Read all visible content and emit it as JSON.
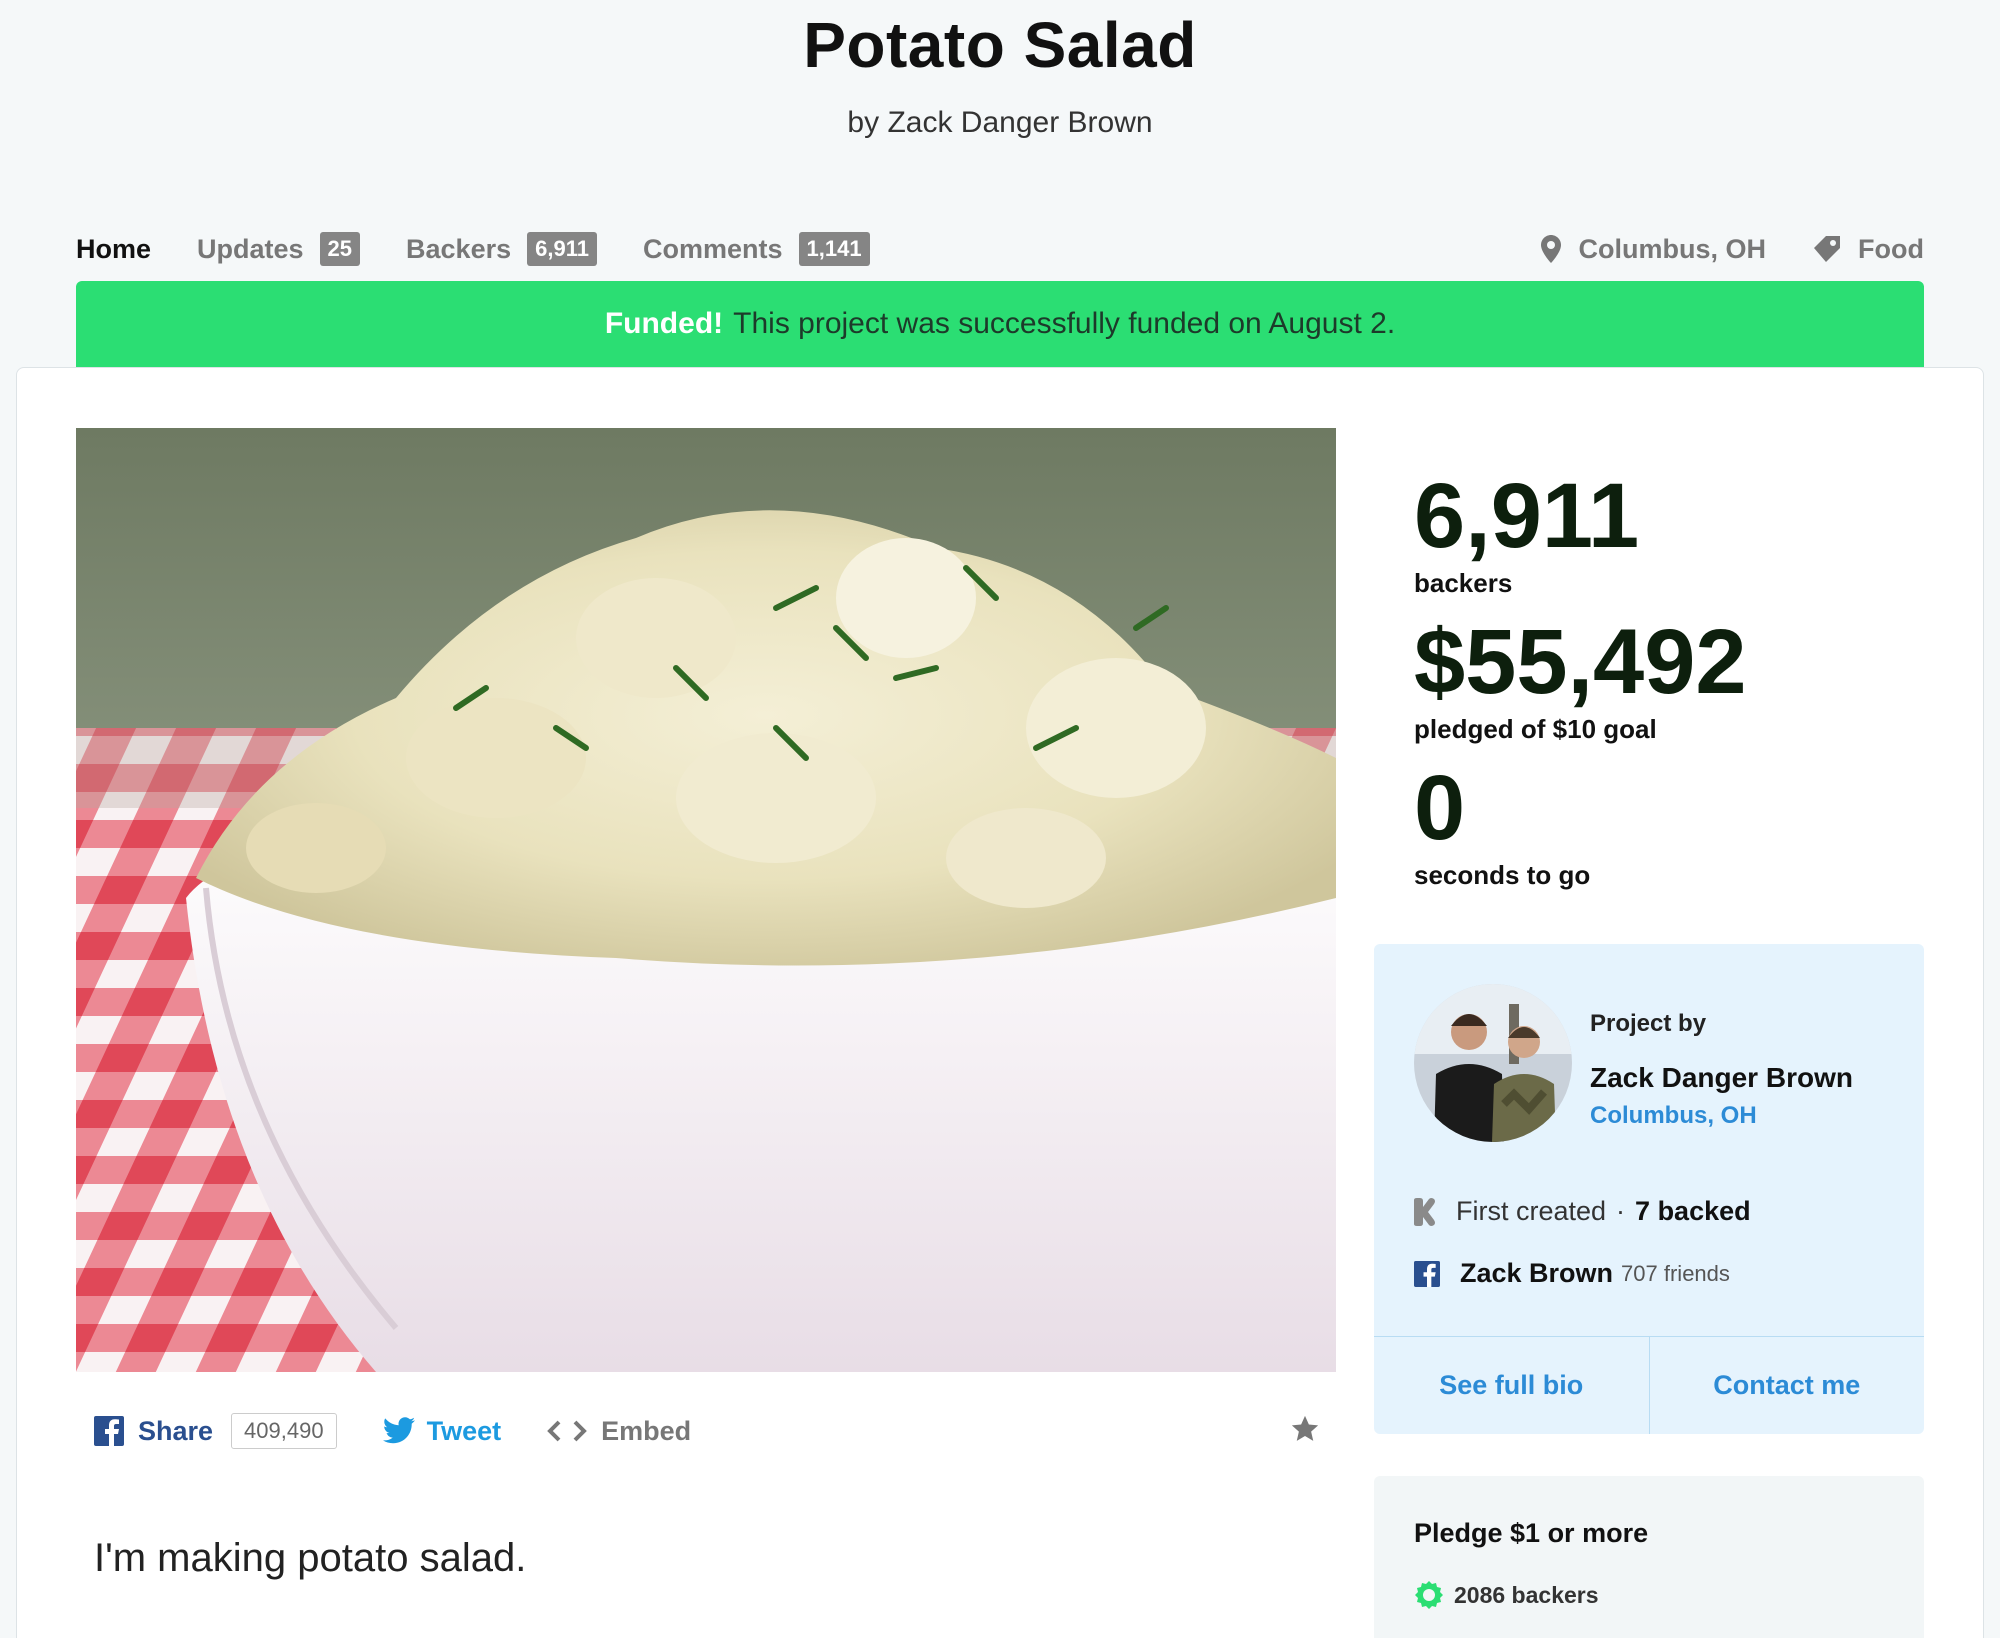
{
  "header": {
    "title": "Potato Salad",
    "byline": "by Zack Danger Brown"
  },
  "nav": {
    "tabs": [
      {
        "label": "Home"
      },
      {
        "label": "Updates",
        "count": "25"
      },
      {
        "label": "Backers",
        "count": "6,911"
      },
      {
        "label": "Comments",
        "count": "1,141"
      }
    ],
    "location": "Columbus, OH",
    "category": "Food"
  },
  "banner": {
    "strong": "Funded!",
    "text": "This project was successfully funded on August 2."
  },
  "share": {
    "share_label": "Share",
    "share_count": "409,490",
    "tweet_label": "Tweet",
    "embed_label": "Embed"
  },
  "description": "I'm making potato salad.",
  "stats": {
    "backers_value": "6,911",
    "backers_label": "backers",
    "pledged_value": "$55,492",
    "pledged_label": "pledged of $10 goal",
    "time_value": "0",
    "time_label": "seconds to go"
  },
  "creator": {
    "project_by": "Project by",
    "name": "Zack Danger Brown",
    "location": "Columbus, OH",
    "first_created": "First created",
    "separator": "·",
    "backed": "7 backed",
    "facebook_name": "Zack Brown",
    "facebook_friends": "707 friends",
    "bio_button": "See full bio",
    "contact_button": "Contact me"
  },
  "reward": {
    "title": "Pledge $1 or more",
    "backers": "2086 backers"
  },
  "colors": {
    "funded_green": "#2bde73",
    "link_blue": "#2c8bd6",
    "creator_bg": "#e5f3fd"
  },
  "icons": [
    "location-pin-icon",
    "tag-icon",
    "facebook-icon",
    "twitter-icon",
    "embed-icon",
    "star-icon",
    "kickstarter-icon",
    "reward-badge-icon"
  ]
}
